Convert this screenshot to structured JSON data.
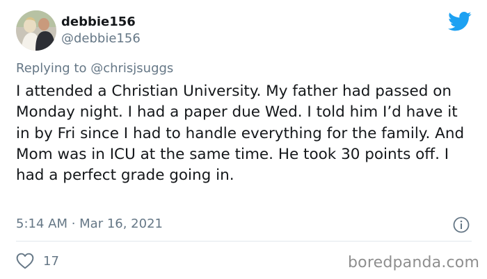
{
  "user": {
    "display_name": "debbie156",
    "handle": "@debbie156",
    "avatar_icon": "profile-photo"
  },
  "reply": {
    "prefix": "Replying to ",
    "mention": "@chrisjsuggs"
  },
  "tweet": {
    "text": "I attended a Christian University. My father had passed on Monday night. I had a paper due Wed. I told him I’d have it in by Fri since I had to handle everything for the family. And Mom was in ICU at the same time. He took 30 points off. I had a perfect grade going in.",
    "timestamp": "5:14 AM · Mar 16, 2021",
    "likes": "17"
  },
  "icons": {
    "brand": "twitter-bird-icon",
    "info": "info-icon",
    "like": "heart-icon"
  },
  "colors": {
    "twitter_blue": "#1da1f2",
    "secondary_text": "#657786",
    "primary_text": "#14171a"
  },
  "watermark": "boredpanda.com"
}
